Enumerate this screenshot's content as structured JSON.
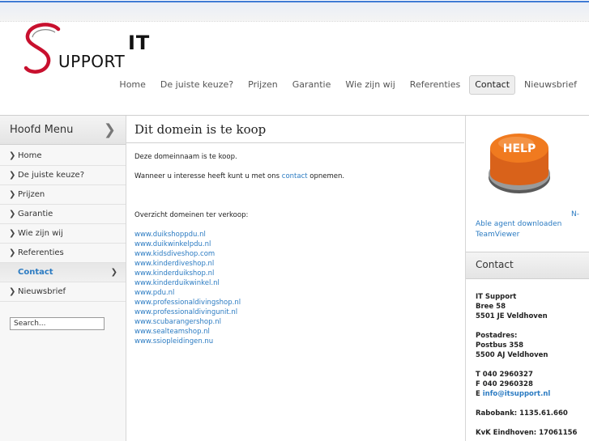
{
  "brand": {
    "it": "IT",
    "support": "UPPORT",
    "s_color": "#c8102e"
  },
  "topnav": [
    {
      "label": "Home",
      "active": false
    },
    {
      "label": "De juiste keuze?",
      "active": false
    },
    {
      "label": "Prijzen",
      "active": false
    },
    {
      "label": "Garantie",
      "active": false
    },
    {
      "label": "Wie zijn wij",
      "active": false
    },
    {
      "label": "Referenties",
      "active": false
    },
    {
      "label": "Contact",
      "active": true
    },
    {
      "label": "Nieuwsbrief",
      "active": false
    }
  ],
  "sidebar": {
    "title": "Hoofd Menu",
    "items": [
      {
        "label": "Home"
      },
      {
        "label": "De juiste keuze?"
      },
      {
        "label": "Prijzen"
      },
      {
        "label": "Garantie"
      },
      {
        "label": "Wie zijn wij"
      },
      {
        "label": "Referenties"
      },
      {
        "label": "Contact",
        "active": true
      },
      {
        "label": "Nieuwsbrief"
      }
    ],
    "search_placeholder": "Search..."
  },
  "main": {
    "title": "Dit domein is te koop",
    "intro": "Deze domeinnaam is te koop.",
    "interest_before": "Wanneer u interesse heeft kunt u met ons ",
    "interest_link": "contact",
    "interest_after": " opnemen.",
    "overview_label": "Overzicht domeinen ter verkoop:",
    "domains": [
      "www.duikshoppdu.nl",
      "www.duikwinkelpdu.nl",
      "www.kidsdiveshop.com",
      "www.kinderdiveshop.nl",
      "www.kinderduikshop.nl",
      "www.kinderduikwinkel.nl",
      "www.pdu.nl",
      "www.professionaldivingshop.nl",
      "www.professionaldivingunit.nl",
      "www.scubarangershop.nl",
      "www.sealteamshop.nl",
      "www.ssiopleidingen.nu"
    ]
  },
  "right": {
    "help_label": "HELP",
    "agent_n": "N-",
    "agent_line": "Able agent downloaden",
    "teamviewer": "TeamViewer",
    "contact_title": "Contact",
    "company": "IT Support",
    "street": "Bree 58",
    "city": "5501 JE Veldhoven",
    "postal_label": "Postadres:",
    "postbus": "Postbus 358",
    "postal_city": "5500 AJ Veldhoven",
    "tel": "T 040 2960327",
    "fax": "F 040 2960328",
    "email_prefix": "E ",
    "email": "info@itsupport.nl",
    "bank": "Rabobank: 1135.61.660",
    "kvk": "KvK Eindhoven: 17061156"
  },
  "colors": {
    "link": "#2b7bc2",
    "accent_bar": "#3f7bd4",
    "help_orange": "#f07a1f"
  }
}
